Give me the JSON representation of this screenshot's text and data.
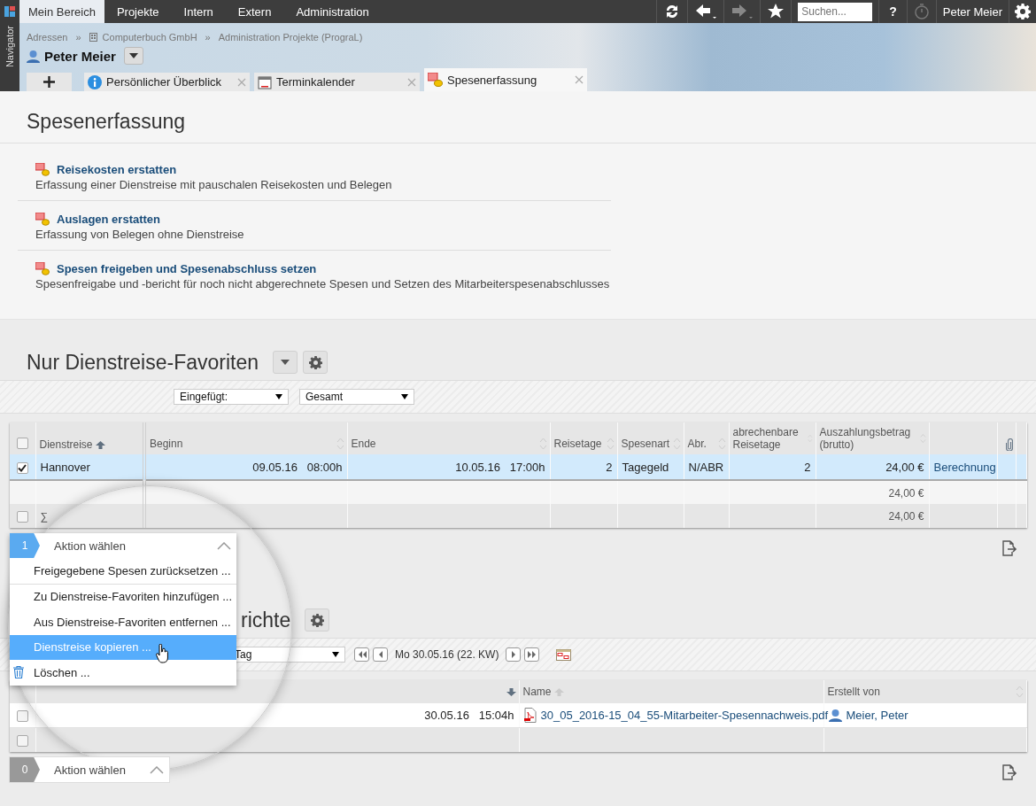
{
  "navigator": {
    "label": "Navigator"
  },
  "menu": [
    {
      "label": "Mein Bereich",
      "selected": true
    },
    {
      "label": "Projekte",
      "selected": false
    },
    {
      "label": "Intern",
      "selected": false
    },
    {
      "label": "Extern",
      "selected": false
    },
    {
      "label": "Administration",
      "selected": false
    }
  ],
  "toolbar": {
    "forward_disabled": true,
    "search_placeholder": "Suchen...",
    "help": "?",
    "timer_disabled": true,
    "user": "Peter Meier"
  },
  "breadcrumb": {
    "separator": "»",
    "items": [
      "Adressen",
      "Computerbuch GmbH",
      "Administration Projekte (PrograL)"
    ]
  },
  "person": {
    "name": "Peter Meier"
  },
  "tabs": [
    {
      "label": "Persönlicher Überblick",
      "selected": false
    },
    {
      "label": "Terminkalender",
      "selected": false
    },
    {
      "label": "Spesenerfassung",
      "selected": true
    }
  ],
  "page_title": "Spesenerfassung",
  "actions": [
    {
      "title": "Reisekosten erstatten",
      "description": "Erfassung einer Dienstreise mit pauschalen Reisekosten und Belegen"
    },
    {
      "title": "Auslagen erstatten",
      "description": "Erfassung von Belegen ohne Dienstreise"
    },
    {
      "title": "Spesen freigeben und Spesenabschluss setzen",
      "description": "Spesenfreigabe und -bericht für noch nicht abgerechnete Spesen und Setzen des Mitarbeiterspesenabschlusses"
    }
  ],
  "favorites": {
    "title": "Nur Dienstreise-Favoriten",
    "filters": [
      "Eingefügt:",
      "Gesamt"
    ],
    "select_all_checked": false,
    "columns": [
      {
        "label": "Dienstreise",
        "kind": "text",
        "sorted": true
      },
      {
        "label": "Beginn",
        "kind": "text",
        "sorted": false
      },
      {
        "label": "Ende",
        "kind": "text",
        "sorted": false
      },
      {
        "label": "Reisetage",
        "kind": "text",
        "sorted": false
      },
      {
        "label": "Spesenart",
        "kind": "text",
        "sorted": false
      },
      {
        "label": "Abr.",
        "kind": "text",
        "sorted": false
      },
      {
        "label": "abrechenbare Reisetage",
        "kind": "text",
        "sorted": false
      },
      {
        "label": "Auszahlungsbetrag (brutto)",
        "kind": "text",
        "sorted": false
      },
      {
        "kind": "link"
      },
      {
        "kind": "attachment"
      }
    ],
    "rows": [
      {
        "checked": true,
        "selected": true,
        "cells": [
          "Hannover",
          "09.05.16   08:00h",
          "10.05.16   17:00h",
          "2",
          "Tagegeld",
          "N/ABR",
          "2",
          "24,00 €",
          "Berechnung"
        ]
      }
    ],
    "subtotal": "24,00 €",
    "total": {
      "label": "∑",
      "value": "24,00 €",
      "checked": false
    },
    "action_menu": {
      "count": "1",
      "label": "Aktion wählen",
      "expanded": true,
      "items": [
        {
          "label": "Freigegebene Spesen zurücksetzen ...",
          "selected": false
        },
        {
          "label": "Zu Dienstreise-Favoriten hinzufügen ...",
          "selected": false
        },
        {
          "label": "Aus Dienstreise-Favoriten entfernen ...",
          "selected": false
        },
        {
          "label": "Dienstreise kopieren ...",
          "selected": true
        },
        {
          "label": "Löschen ...",
          "selected": false
        }
      ]
    }
  },
  "reports": {
    "title": "richte",
    "period": "Tag",
    "date": "Mo 30.05.16 (22. KW)",
    "columns": [
      {
        "kind": "date",
        "sorted": true
      },
      {
        "label": "Name",
        "kind": "text",
        "sorted": false
      },
      {
        "label": "Erstellt von",
        "kind": "text",
        "sorted": false
      }
    ],
    "rows": [
      {
        "checked": false,
        "created": "30.05.16   15:04h",
        "name": "30_05_2016-15_04_55-Mitarbeiter-Spesennachweis.pdf",
        "author": "Meier, Peter"
      }
    ],
    "footer_checked": false,
    "action_menu": {
      "count": "0",
      "label": "Aktion wählen"
    }
  }
}
